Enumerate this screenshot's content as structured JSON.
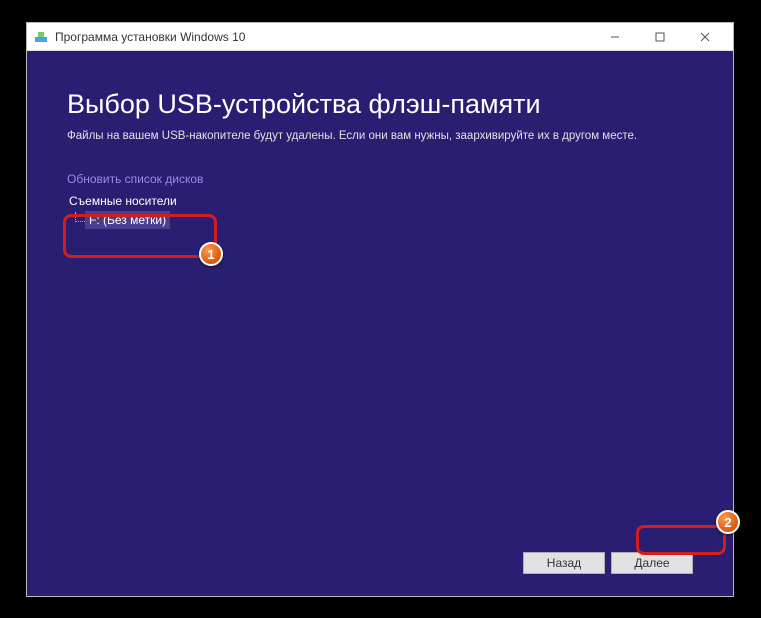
{
  "titlebar": {
    "title": "Программа установки Windows 10"
  },
  "content": {
    "heading": "Выбор USB-устройства флэш-памяти",
    "subtext": "Файлы на вашем USB-накопителе будут удалены. Если они вам нужны, заархивируйте их в другом месте.",
    "refresh_link": "Обновить список дисков",
    "drive_group_label": "Съемные носители",
    "drive_item": "F: (Без метки)"
  },
  "footer": {
    "back_label": "Назад",
    "next_label": "Далее"
  },
  "annotations": {
    "badge1": "1",
    "badge2": "2"
  }
}
